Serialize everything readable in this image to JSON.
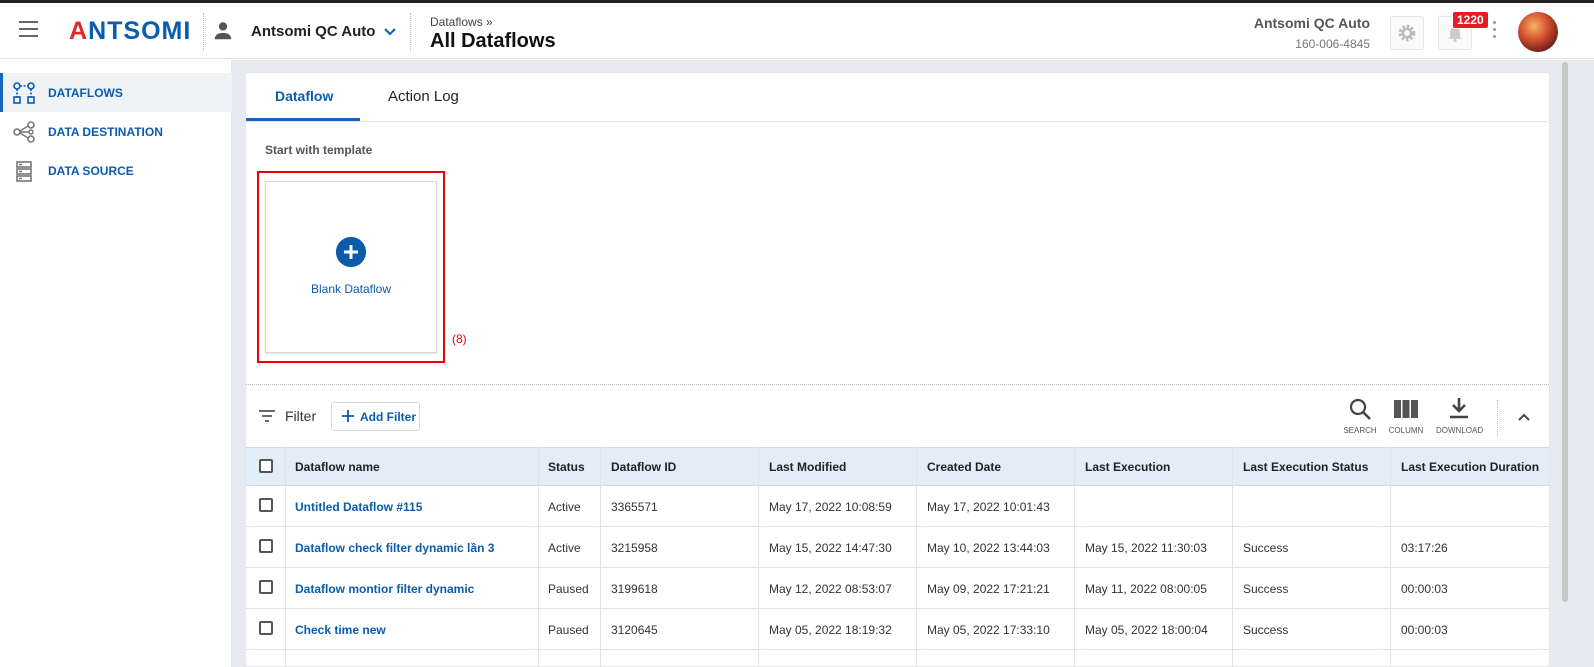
{
  "header": {
    "logo": "ANTSOMI",
    "account_name": "Antsomi QC Auto",
    "breadcrumb": "Dataflows »",
    "page_title": "All Dataflows",
    "portal_name": "Antsomi QC Auto",
    "portal_id": "160-006-4845",
    "notification_count": "1220"
  },
  "sidebar": {
    "items": [
      {
        "label": "DATAFLOWS",
        "icon": "dataflow-icon",
        "active": true
      },
      {
        "label": "DATA DESTINATION",
        "icon": "share-nodes-icon",
        "active": false
      },
      {
        "label": "DATA SOURCE",
        "icon": "database-icon",
        "active": false
      }
    ]
  },
  "tabs": [
    {
      "label": "Dataflow",
      "active": true
    },
    {
      "label": "Action Log",
      "active": false
    }
  ],
  "templates": {
    "title": "Start with template",
    "blank_label": "Blank Dataflow",
    "annotation": "(8)"
  },
  "toolbar": {
    "filter_label": "Filter",
    "add_filter_label": "Add Filter",
    "search_label": "SEARCH",
    "column_label": "COLUMN",
    "download_label": "DOWNLOAD"
  },
  "table": {
    "columns": [
      "Dataflow name",
      "Status",
      "Dataflow ID",
      "Last Modified",
      "Created Date",
      "Last Execution",
      "Last Execution Status",
      "Last Execution Duration"
    ],
    "rows": [
      [
        "Untitled Dataflow #115",
        "Active",
        "3365571",
        "May 17, 2022 10:08:59",
        "May 17, 2022 10:01:43",
        "",
        "",
        ""
      ],
      [
        "Dataflow check filter dynamic lần 3",
        "Active",
        "3215958",
        "May 15, 2022 14:47:30",
        "May 10, 2022 13:44:03",
        "May 15, 2022 11:30:03",
        "Success",
        "03:17:26"
      ],
      [
        "Dataflow montior filter dynamic",
        "Paused",
        "3199618",
        "May 12, 2022 08:53:07",
        "May 09, 2022 17:21:21",
        "May 11, 2022 08:00:05",
        "Success",
        "00:00:03"
      ],
      [
        "Check time new",
        "Paused",
        "3120645",
        "May 05, 2022 18:19:32",
        "May 05, 2022 17:33:10",
        "May 05, 2022 18:00:04",
        "Success",
        "00:00:03"
      ]
    ]
  },
  "colors": {
    "brand_blue": "#0b5cad",
    "accent_blue": "#1565c0",
    "annotation_red": "#e00000",
    "badge_red": "#e51c23"
  }
}
